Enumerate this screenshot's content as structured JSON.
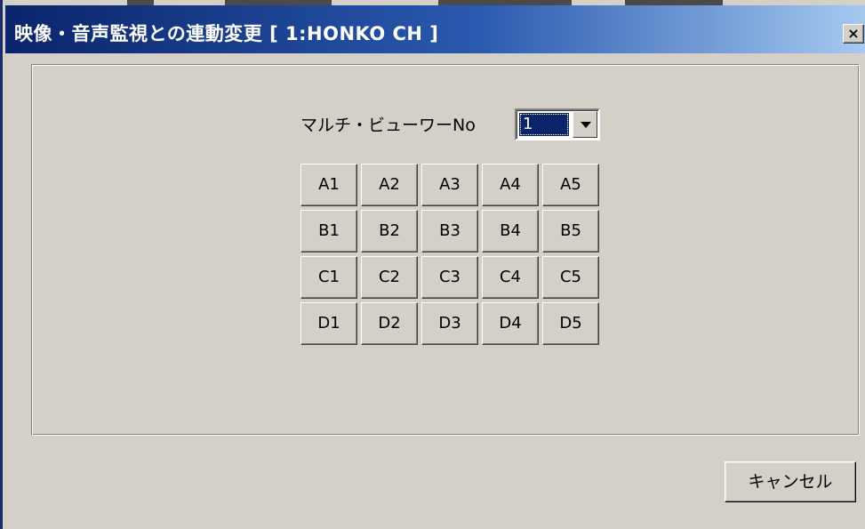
{
  "window": {
    "title": "映像・音声監視との連動変更 [ 1:HONKO  CH ]",
    "close_label": "×",
    "title_gradient_start": "#0a246a",
    "title_gradient_end": "#a6caf0"
  },
  "viewer": {
    "label": "マルチ・ビューワーNo",
    "selected": "1"
  },
  "grid": {
    "rows": [
      [
        "A1",
        "A2",
        "A3",
        "A4",
        "A5"
      ],
      [
        "B1",
        "B2",
        "B3",
        "B4",
        "B5"
      ],
      [
        "C1",
        "C2",
        "C3",
        "C4",
        "C5"
      ],
      [
        "D1",
        "D2",
        "D3",
        "D4",
        "D5"
      ]
    ]
  },
  "footer": {
    "cancel_label": "キャンセル"
  },
  "colors": {
    "face": "#d4d0c8",
    "selection": "#0a246a"
  }
}
